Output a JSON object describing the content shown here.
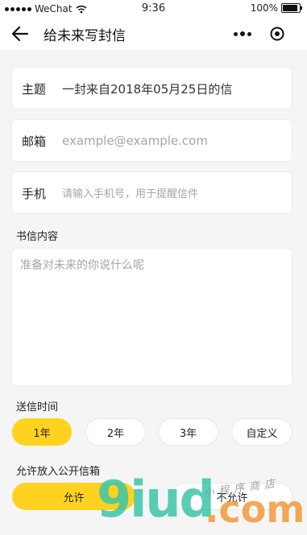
{
  "status_bar": {
    "signal": "●●●●●",
    "carrier": "WeChat",
    "time": "9:36",
    "battery": "100%"
  },
  "nav": {
    "title": "给未来写封信",
    "back_icon": "back-arrow-icon",
    "more_icon": "more-dots-icon",
    "close_icon": "capsule-close-icon"
  },
  "form": {
    "subject": {
      "label": "主题",
      "value": "一封来自2018年05月25日的信"
    },
    "email": {
      "label": "邮箱",
      "placeholder": "example@example.com"
    },
    "phone": {
      "label": "手机",
      "placeholder": "请输入手机号，用于提醒信件"
    }
  },
  "letter": {
    "label": "书信内容",
    "placeholder": "准备对未来的你说什么呢"
  },
  "send_time": {
    "label": "送信时间",
    "options": [
      "1年",
      "2年",
      "3年",
      "自定义"
    ],
    "selected": "1年"
  },
  "public": {
    "label": "允许放入公开信箱",
    "options": [
      "允许",
      "不允许"
    ],
    "selected": "允许"
  },
  "watermark": {
    "big": "9iud",
    "suffix": ".com",
    "small": "小程序商店"
  },
  "colors": {
    "accent": "#ffd21f",
    "background": "#f5f5f5",
    "watermark_green": "#3cc6a8",
    "watermark_orange": "#f29a3a"
  }
}
